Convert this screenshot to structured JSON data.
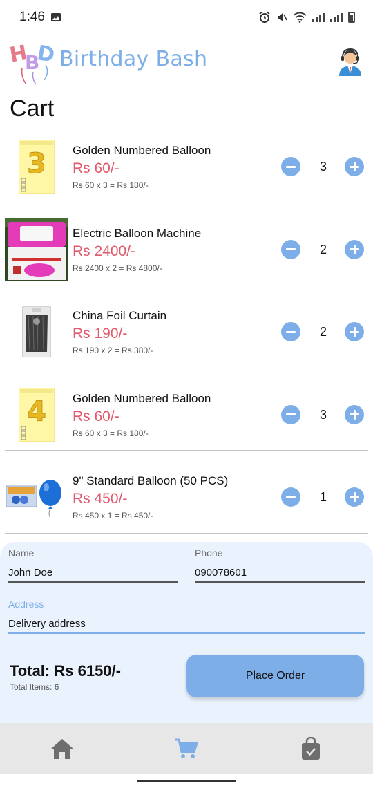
{
  "status_bar": {
    "time": "1:46"
  },
  "app": {
    "title": "Birthday Bash",
    "logo_text": "HBD"
  },
  "page": {
    "title": "Cart"
  },
  "cart": {
    "items": [
      {
        "name": "Golden Numbered Balloon",
        "price": "Rs 60/-",
        "calc": "Rs 60 x 3 = Rs 180/-",
        "qty": "3",
        "thumb_icon": "gold-balloon-3-image",
        "thumb_glyph": "3"
      },
      {
        "name": "Electric Balloon Machine",
        "price": "Rs 2400/-",
        "calc": "Rs 2400 x 2 = Rs 4800/-",
        "qty": "2",
        "thumb_icon": "balloon-pump-image"
      },
      {
        "name": "China Foil Curtain",
        "price": "Rs 190/-",
        "calc": "Rs 190 x 2 = Rs 380/-",
        "qty": "2",
        "thumb_icon": "foil-curtain-image"
      },
      {
        "name": "Golden Numbered Balloon",
        "price": "Rs 60/-",
        "calc": "Rs 60 x 3 = Rs 180/-",
        "qty": "3",
        "thumb_icon": "gold-balloon-4-image",
        "thumb_glyph": "4"
      },
      {
        "name": "9\" Standard Balloon (50 PCS)",
        "price": "Rs 450/-",
        "calc": "Rs 450 x 1 = Rs 450/-",
        "qty": "1",
        "thumb_icon": "blue-balloon-pack-image"
      }
    ]
  },
  "order_form": {
    "name_label": "Name",
    "name_value": "John Doe",
    "phone_label": "Phone",
    "phone_value": "090078601",
    "address_label": "Address",
    "address_value": "Delivery address"
  },
  "summary": {
    "total": "Total: Rs 6150/-",
    "total_items": "Total Items: 6",
    "place_order_label": "Place Order"
  },
  "nav": {
    "items": [
      {
        "icon": "home-icon",
        "active": false
      },
      {
        "icon": "cart-icon",
        "active": true
      },
      {
        "icon": "shopping-bag-icon",
        "active": false
      }
    ]
  },
  "colors": {
    "accent": "#7eaee8",
    "price": "#e0596c",
    "panel_bg": "#eaf2fd",
    "nav_bg": "#e7e7e7",
    "nav_inactive": "#6e6e6e"
  }
}
